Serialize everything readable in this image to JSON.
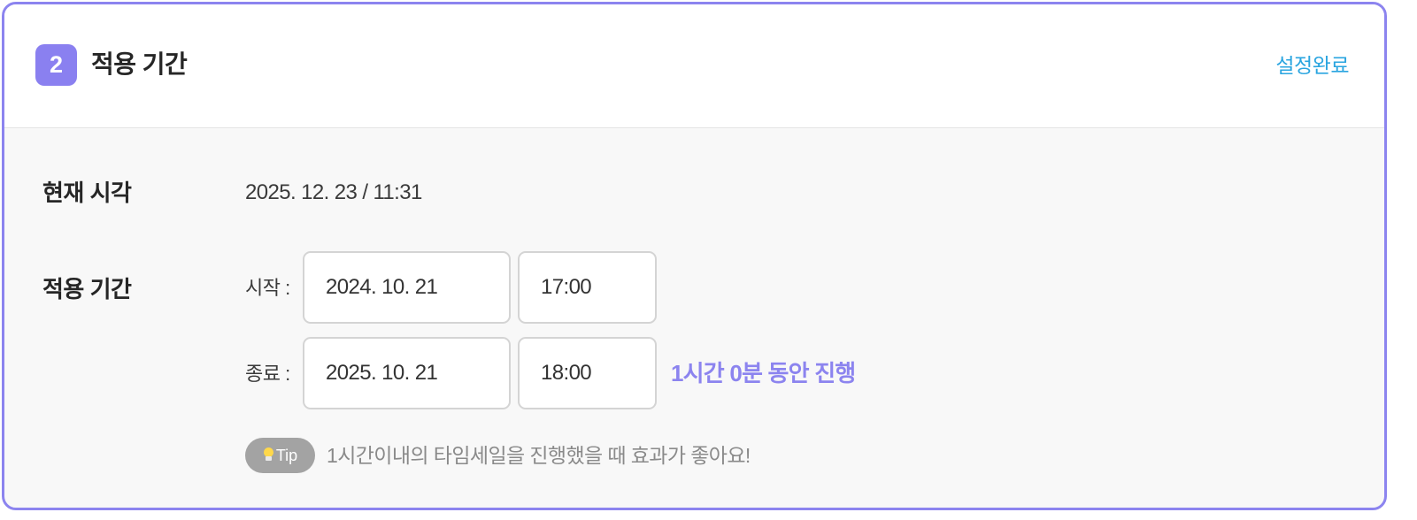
{
  "header": {
    "step_number": "2",
    "title": "적용 기간",
    "done_label": "설정완료"
  },
  "current_time": {
    "label": "현재 시각",
    "value": "2025. 12. 23 / 11:31"
  },
  "period": {
    "label": "적용 기간",
    "start": {
      "label": "시작 :",
      "date": "2024. 10. 21",
      "time": "17:00"
    },
    "end": {
      "label": "종료 :",
      "date": "2025. 10. 21",
      "time": "18:00"
    },
    "duration_text": "1시간 0분 동안 진행"
  },
  "tip": {
    "badge_label": "Tip",
    "badge_icon": "lightbulb-icon",
    "text": "1시간이내의 타임세일을 진행했을 때 효과가 좋아요!"
  },
  "colors": {
    "accent": "#8c84ef",
    "link": "#2aa5e0",
    "tip_badge": "#a3a3a3"
  }
}
